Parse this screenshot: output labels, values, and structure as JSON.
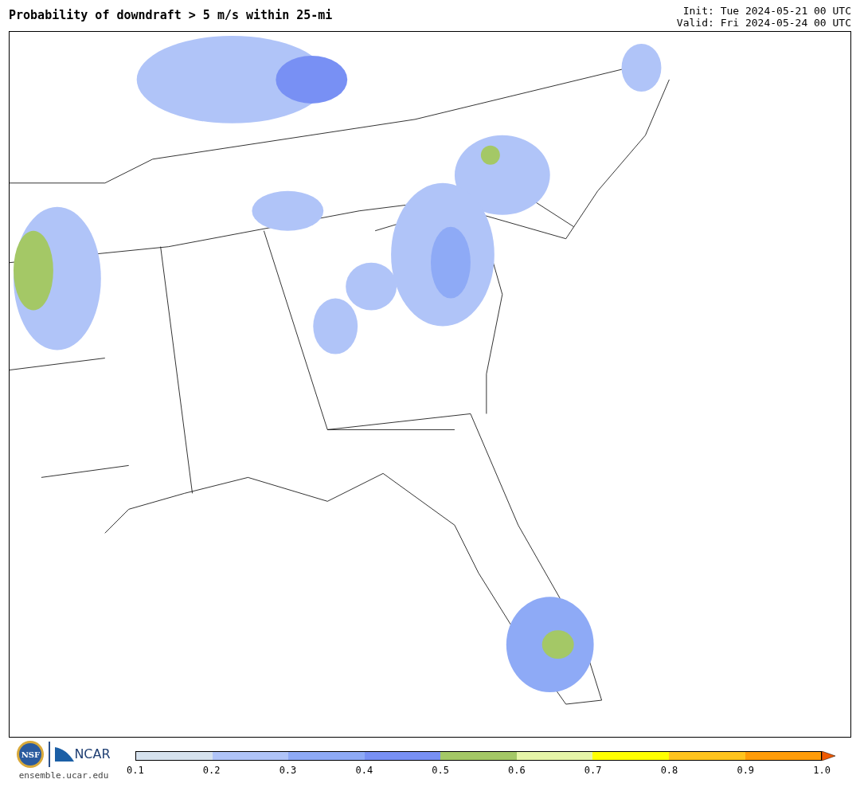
{
  "header": {
    "title": "Probability of downdraft > 5 m/s within 25-mi",
    "init": "Init: Tue 2024-05-21 00 UTC",
    "valid": "Valid: Fri 2024-05-24 00 UTC"
  },
  "footer": {
    "nsf_logo_text": "NSF",
    "ncar_logo_text": "NCAR",
    "url": "ensemble.ucar.edu"
  },
  "colorbar": {
    "bins": [
      {
        "color": "#d6e2ee"
      },
      {
        "color": "#b0c4f8"
      },
      {
        "color": "#8eaaf6"
      },
      {
        "color": "#7890f4"
      },
      {
        "color": "#a4c866"
      },
      {
        "color": "#e6f5a8"
      },
      {
        "color": "#ffff00"
      },
      {
        "color": "#ffc41e"
      },
      {
        "color": "#ff9c08"
      }
    ],
    "extend_arrow": {
      "color": "#f05a00"
    },
    "ticks": [
      "0.1",
      "0.2",
      "0.3",
      "0.4",
      "0.5",
      "0.6",
      "0.7",
      "0.8",
      "0.9",
      "1.0"
    ]
  }
}
